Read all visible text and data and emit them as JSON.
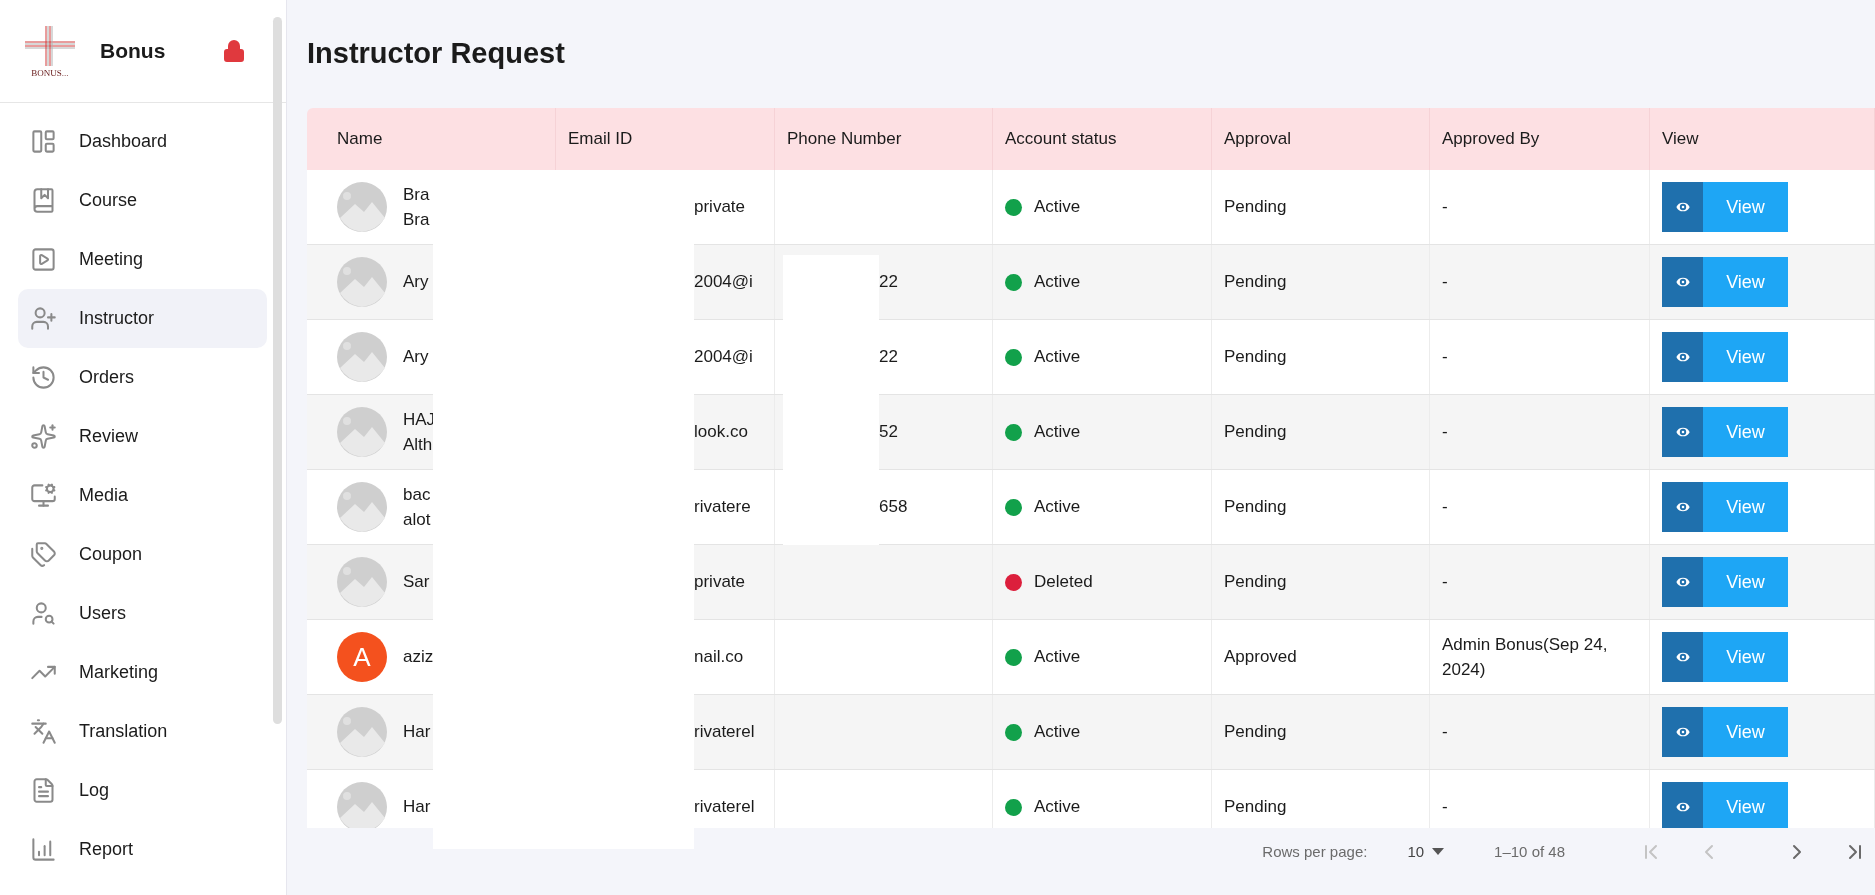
{
  "sidebar": {
    "brand": "Bonus",
    "logo_caption": "BONUS...",
    "items": [
      {
        "label": "Dashboard",
        "selected": false
      },
      {
        "label": "Course",
        "selected": false
      },
      {
        "label": "Meeting",
        "selected": false
      },
      {
        "label": "Instructor",
        "selected": true
      },
      {
        "label": "Orders",
        "selected": false
      },
      {
        "label": "Review",
        "selected": false
      },
      {
        "label": "Media",
        "selected": false
      },
      {
        "label": "Coupon",
        "selected": false
      },
      {
        "label": "Users",
        "selected": false
      },
      {
        "label": "Marketing",
        "selected": false
      },
      {
        "label": "Translation",
        "selected": false
      },
      {
        "label": "Log",
        "selected": false
      },
      {
        "label": "Report",
        "selected": false
      }
    ]
  },
  "page_title": "Instructor Request",
  "table": {
    "columns": [
      "Name",
      "Email ID",
      "Phone Number",
      "Account status",
      "Approval",
      "Approved By",
      "View"
    ],
    "rows": [
      {
        "avatar": {
          "kind": "placeholder"
        },
        "name": "Bra\nBra",
        "email": "private",
        "phone": "",
        "status": "Active",
        "color": "#12a14b",
        "approval": "Pending",
        "approved_by": "-",
        "action": "View"
      },
      {
        "avatar": {
          "kind": "placeholder"
        },
        "name": "Ary",
        "email": "2004@i",
        "phone": "22",
        "status": "Active",
        "color": "#12a14b",
        "approval": "Pending",
        "approved_by": "-",
        "action": "View"
      },
      {
        "avatar": {
          "kind": "placeholder"
        },
        "name": "Ary",
        "email": "2004@i",
        "phone": "22",
        "status": "Active",
        "color": "#12a14b",
        "approval": "Pending",
        "approved_by": "-",
        "action": "View"
      },
      {
        "avatar": {
          "kind": "placeholder"
        },
        "name": "HAJ\nAlth",
        "email": "look.co",
        "phone": "52",
        "status": "Active",
        "color": "#12a14b",
        "approval": "Pending",
        "approved_by": "-",
        "action": "View"
      },
      {
        "avatar": {
          "kind": "placeholder"
        },
        "name": "bac\nalot",
        "email": "rivatere",
        "phone": "658",
        "status": "Active",
        "color": "#12a14b",
        "approval": "Pending",
        "approved_by": "-",
        "action": "View"
      },
      {
        "avatar": {
          "kind": "placeholder"
        },
        "name": "Sar",
        "email": "private",
        "phone": "",
        "status": "Deleted",
        "color": "#dc1f3c",
        "approval": "Pending",
        "approved_by": "-",
        "action": "View"
      },
      {
        "avatar": {
          "kind": "letter",
          "letter": "A",
          "color": "#f4511e"
        },
        "name": "aziz",
        "email": "nail.co",
        "phone": "",
        "status": "Active",
        "color": "#12a14b",
        "approval": "Approved",
        "approved_by": "Admin Bonus(Sep 24, 2024)",
        "action": "View"
      },
      {
        "avatar": {
          "kind": "placeholder"
        },
        "name": "Har",
        "email": "rivaterel",
        "phone": "",
        "status": "Active",
        "color": "#12a14b",
        "approval": "Pending",
        "approved_by": "-",
        "action": "View"
      },
      {
        "avatar": {
          "kind": "placeholder"
        },
        "name": "Har",
        "email": "rivaterel",
        "phone": "",
        "status": "Active",
        "color": "#12a14b",
        "approval": "Pending",
        "approved_by": "-",
        "action": "View"
      }
    ]
  },
  "pagination": {
    "rows_per_page_label": "Rows per page:",
    "rows_per_page": "10",
    "range": "1–10 of 48",
    "first_disabled": true,
    "prev_disabled": true,
    "next_disabled": false,
    "last_disabled": false
  }
}
